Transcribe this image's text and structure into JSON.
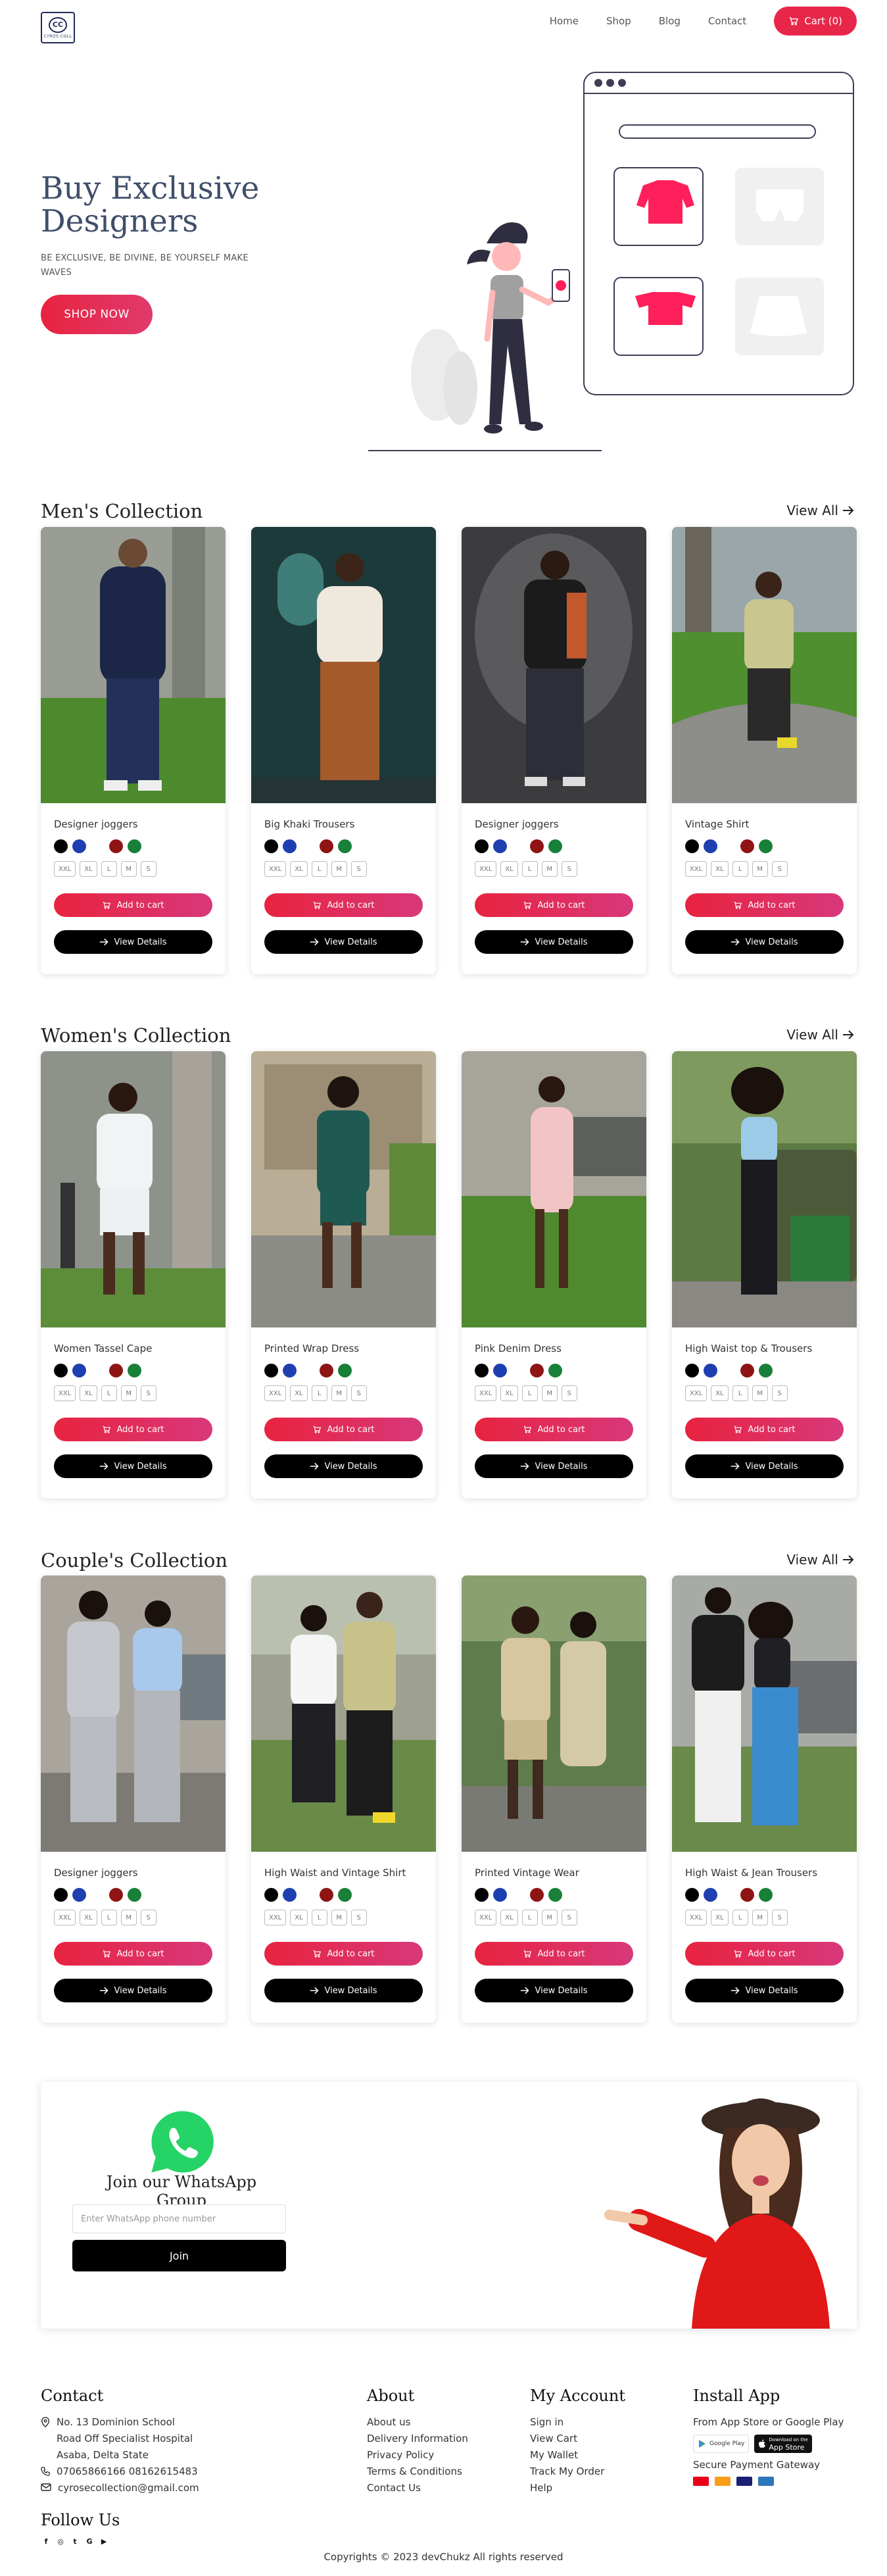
{
  "header": {
    "logo_text": "CYROS COLL",
    "logo_mark": "CC",
    "nav": [
      "Home",
      "Shop",
      "Blog",
      "Contact"
    ],
    "cart_label": "Cart (0)"
  },
  "hero": {
    "title": "Buy Exclusive Designers",
    "subtitle": "BE EXCLUSIVE, BE DIVINE, BE YOURSELF MAKE WAVES",
    "cta": "SHOP NOW"
  },
  "colors": {
    "accent": "#e8264a",
    "swatches": [
      "#000000",
      "#1e3fb0",
      "#ffffff",
      "#8f1414",
      "#188038"
    ]
  },
  "sizes": [
    "XXL",
    "XL",
    "L",
    "M",
    "S"
  ],
  "buttons": {
    "add": "Add to cart",
    "view": "View Details"
  },
  "sections": [
    {
      "title": "Men's Collection",
      "view_all": "View All",
      "products": [
        {
          "name": "Designer joggers"
        },
        {
          "name": "Big Khaki Trousers"
        },
        {
          "name": "Designer joggers"
        },
        {
          "name": "Vintage Shirt"
        }
      ]
    },
    {
      "title": "Women's Collection",
      "view_all": "View All",
      "products": [
        {
          "name": "Women Tassel Cape"
        },
        {
          "name": "Printed Wrap Dress"
        },
        {
          "name": "Pink Denim Dress"
        },
        {
          "name": "High Waist top & Trousers"
        }
      ]
    },
    {
      "title": "Couple's Collection",
      "view_all": "View All",
      "products": [
        {
          "name": "Designer joggers"
        },
        {
          "name": "High Waist and Vintage Shirt"
        },
        {
          "name": "Printed Vintage Wear"
        },
        {
          "name": "High Waist & Jean Trousers"
        }
      ]
    }
  ],
  "whatsapp": {
    "title": "Join our WhatsApp Group",
    "placeholder": "Enter WhatsApp phone number",
    "join": "Join"
  },
  "footer": {
    "contact": {
      "title": "Contact",
      "address": [
        "No. 13 Dominion School",
        "Road Off Specialist Hospital",
        "Asaba, Delta State"
      ],
      "phone": "07065866166 08162615483",
      "email": "cyrosecollection@gmail.com"
    },
    "follow": "Follow Us",
    "about": {
      "title": "About",
      "items": [
        "About us",
        "Delivery Information",
        "Privacy Policy",
        "Terms & Conditions",
        "Contact Us"
      ]
    },
    "account": {
      "title": "My Account",
      "items": [
        "Sign in",
        "View Cart",
        "My Wallet",
        "Track My Order",
        "Help"
      ]
    },
    "install": {
      "title": "Install App",
      "text": "From App Store or Google Play",
      "google": "Google Play",
      "apple_small": "Download on the",
      "apple": "App Store",
      "gateway": "Secure Payment Gateway"
    },
    "copyright": "Copyrights © 2023 devChukz All rights reserved"
  }
}
